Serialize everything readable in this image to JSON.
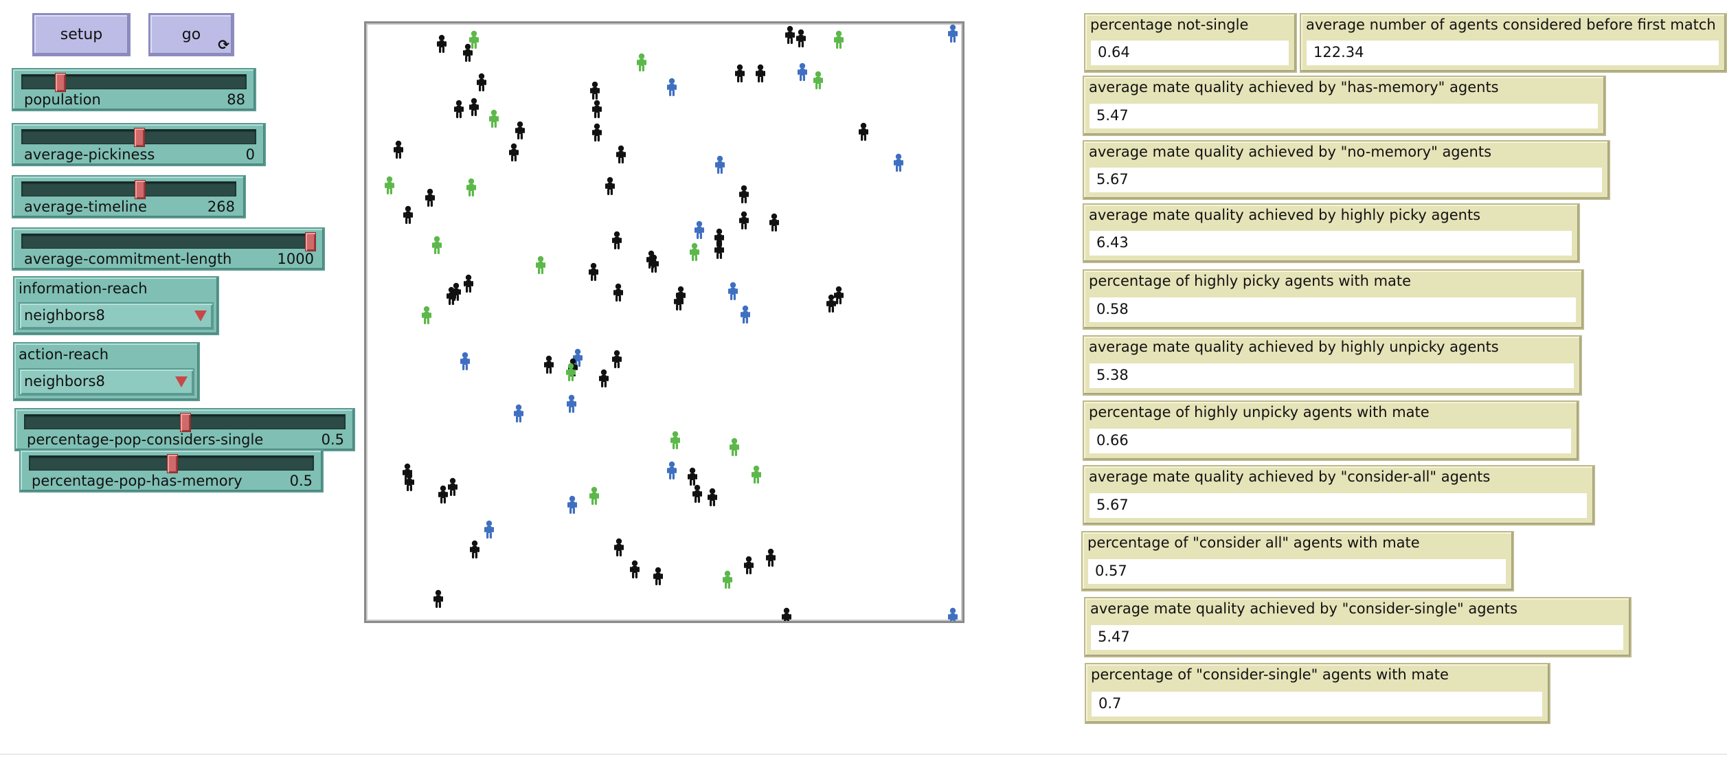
{
  "buttons": {
    "setup_label": "setup",
    "go_label": "go",
    "go_icon": "forever-icon"
  },
  "sliders": [
    {
      "id": "population",
      "label": "population",
      "value": "88",
      "fraction": 0.17
    },
    {
      "id": "average-pickiness",
      "label": "average-pickiness",
      "value": "0",
      "fraction": 0.5
    },
    {
      "id": "average-timeline",
      "label": "average-timeline",
      "value": "268",
      "fraction": 0.55
    },
    {
      "id": "average-commitment-length",
      "label": "average-commitment-length",
      "value": "1000",
      "fraction": 1.0
    },
    {
      "id": "percentage-pop-considers-single",
      "label": "percentage-pop-considers-single",
      "value": "0.5",
      "fraction": 0.5
    },
    {
      "id": "percentage-pop-has-memory",
      "label": "percentage-pop-has-memory",
      "value": "0.5",
      "fraction": 0.5
    }
  ],
  "choosers": [
    {
      "id": "information-reach",
      "label": "information-reach",
      "value": "neighbors8"
    },
    {
      "id": "action-reach",
      "label": "action-reach",
      "value": "neighbors8"
    }
  ],
  "monitors": [
    {
      "id": "m0",
      "label": "percentage not-single",
      "value": "0.64"
    },
    {
      "id": "m1",
      "label": "average number of agents considered before first match",
      "value": "122.34"
    },
    {
      "id": "m2",
      "label": "average mate quality achieved by \"has-memory\" agents",
      "value": "5.47"
    },
    {
      "id": "m3",
      "label": "average mate quality achieved by \"no-memory\" agents",
      "value": "5.67"
    },
    {
      "id": "m4",
      "label": "average mate quality achieved by highly picky agents",
      "value": "6.43"
    },
    {
      "id": "m5",
      "label": "percentage of highly picky agents with mate",
      "value": "0.58"
    },
    {
      "id": "m6",
      "label": "average mate quality achieved by highly unpicky agents",
      "value": "5.38"
    },
    {
      "id": "m7",
      "label": "percentage of highly unpicky agents with mate",
      "value": "0.66"
    },
    {
      "id": "m8",
      "label": "average mate quality achieved by \"consider-all\" agents",
      "value": "5.67"
    },
    {
      "id": "m9",
      "label": "percentage of \"consider all\" agents with mate",
      "value": "0.57"
    },
    {
      "id": "m10",
      "label": "average mate quality achieved by \"consider-single\" agents",
      "value": "5.47"
    },
    {
      "id": "m11",
      "label": "percentage of \"consider-single\" agents with mate",
      "value": "0.7"
    }
  ],
  "world": {
    "agent_colors": {
      "black": "#111111",
      "green": "#5cb84a",
      "blue": "#3f6fc0"
    }
  }
}
